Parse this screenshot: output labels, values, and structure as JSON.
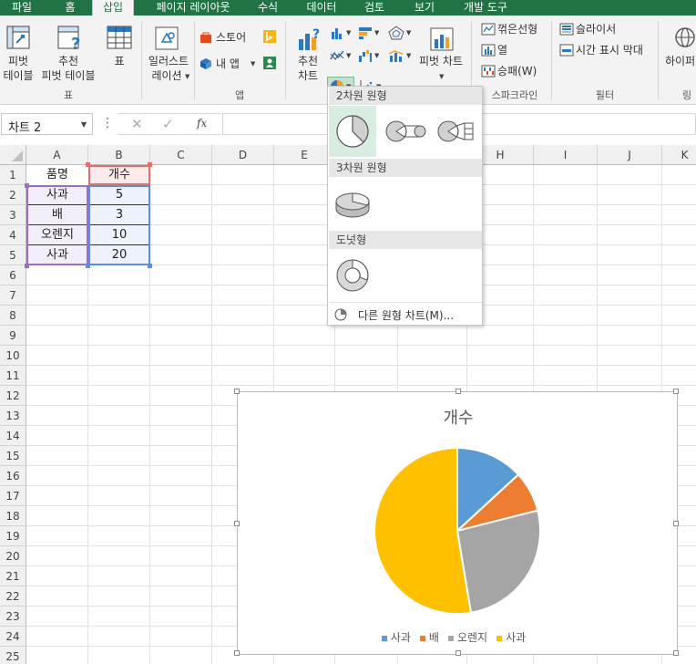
{
  "tabs": [
    {
      "label": "파일",
      "active": false
    },
    {
      "label": "홈",
      "active": false
    },
    {
      "label": "삽입",
      "active": true
    },
    {
      "label": "페이지 레이아웃",
      "active": false
    },
    {
      "label": "수식",
      "active": false
    },
    {
      "label": "데이터",
      "active": false
    },
    {
      "label": "검토",
      "active": false
    },
    {
      "label": "보기",
      "active": false
    },
    {
      "label": "개발 도구",
      "active": false
    }
  ],
  "ribbon": {
    "tables": {
      "pivot_table_l1": "피벗",
      "pivot_table_l2": "테이블",
      "rec_pivot_l1": "추천",
      "rec_pivot_l2": "피벗 테이블",
      "table": "표",
      "group": "표"
    },
    "illustrations": {
      "l1": "일러스트",
      "l2": "레이션"
    },
    "apps": {
      "store": "스토어",
      "my_apps": "내 앱",
      "group": "앱"
    },
    "charts": {
      "rec_l1": "추천",
      "rec_l2": "차트",
      "pivot_chart": "피벗 차트"
    },
    "sparklines": {
      "line": "꺾은선형",
      "column": "열",
      "winloss": "승패(W)",
      "group": "스파크라인"
    },
    "filters": {
      "slicer": "슬라이서",
      "timeline": "시간 표시 막대",
      "group": "필터"
    },
    "links": {
      "hyperlink": "하이퍼",
      "group": "링크"
    }
  },
  "formula_bar": {
    "name_box": "차트 2",
    "fx": "fx",
    "formula": ""
  },
  "columns": [
    "A",
    "B",
    "C",
    "D",
    "E",
    "F",
    "G",
    "H",
    "I",
    "J",
    "K"
  ],
  "rows": [
    "1",
    "2",
    "3",
    "4",
    "5",
    "6",
    "7",
    "8",
    "9",
    "10",
    "11",
    "12",
    "13",
    "14",
    "15",
    "16",
    "17",
    "18",
    "19",
    "20",
    "21",
    "22",
    "23",
    "24",
    "25"
  ],
  "table": {
    "headers": [
      "품명",
      "개수"
    ],
    "rows": [
      [
        "사과",
        "5"
      ],
      [
        "배",
        "3"
      ],
      [
        "오렌지",
        "10"
      ],
      [
        "사과",
        "20"
      ]
    ]
  },
  "dropdown": {
    "section_2d": "2차원 원형",
    "section_3d": "3차원 원형",
    "section_donut": "도넛형",
    "more": "다른 원형 차트(M)..."
  },
  "chart_data": {
    "type": "pie",
    "title": "개수",
    "categories": [
      "사과",
      "배",
      "오렌지",
      "사과"
    ],
    "values": [
      5,
      3,
      10,
      20
    ],
    "colors": [
      "#5b9bd5",
      "#ed7d31",
      "#a5a5a5",
      "#ffc000"
    ],
    "legend_position": "bottom"
  }
}
